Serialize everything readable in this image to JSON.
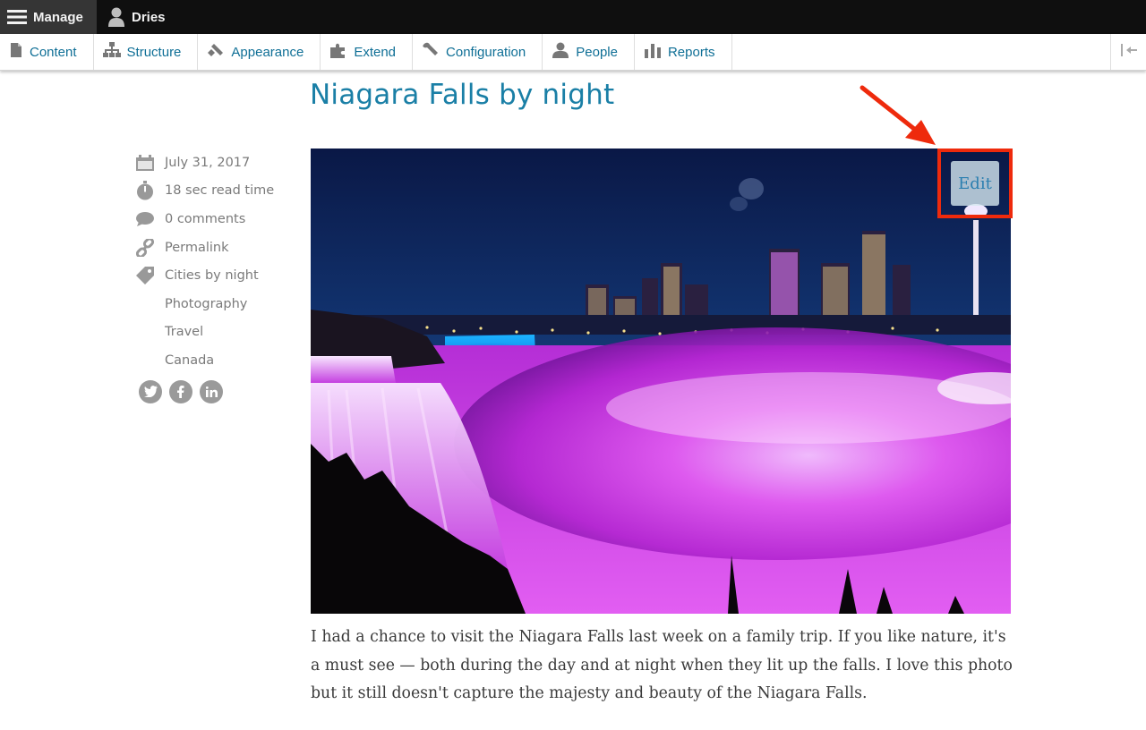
{
  "admin_bar": {
    "manage_label": "Manage",
    "user_label": "Dries"
  },
  "toolbar": {
    "items": [
      {
        "label": "Content",
        "icon": "document-icon"
      },
      {
        "label": "Structure",
        "icon": "sitemap-icon"
      },
      {
        "label": "Appearance",
        "icon": "paintbrush-icon"
      },
      {
        "label": "Extend",
        "icon": "puzzle-icon"
      },
      {
        "label": "Configuration",
        "icon": "wrench-icon"
      },
      {
        "label": "People",
        "icon": "person-icon"
      },
      {
        "label": "Reports",
        "icon": "bar-chart-icon"
      }
    ]
  },
  "article": {
    "title": "Niagara Falls by night",
    "date": "July 31, 2017",
    "read_time": "18 sec read time",
    "comments": "0 comments",
    "permalink": "Permalink",
    "tags": [
      "Cities by night",
      "Photography",
      "Travel",
      "Canada"
    ],
    "share_icons": [
      "twitter-icon",
      "facebook-icon",
      "linkedin-icon"
    ],
    "edit_label": "Edit",
    "body": "I had a chance to visit the Niagara Falls last week on a family trip. If you like nature, it's a must see — both during the day and at night when they lit up the falls. I love this photo but it still doesn't capture the majesty and beauty of the Niagara Falls."
  },
  "colors": {
    "link": "#1a7fa6",
    "toolbar_link": "#0f6f96",
    "highlight": "#ee2a0c",
    "admin_bar": "#0f0f0f"
  }
}
